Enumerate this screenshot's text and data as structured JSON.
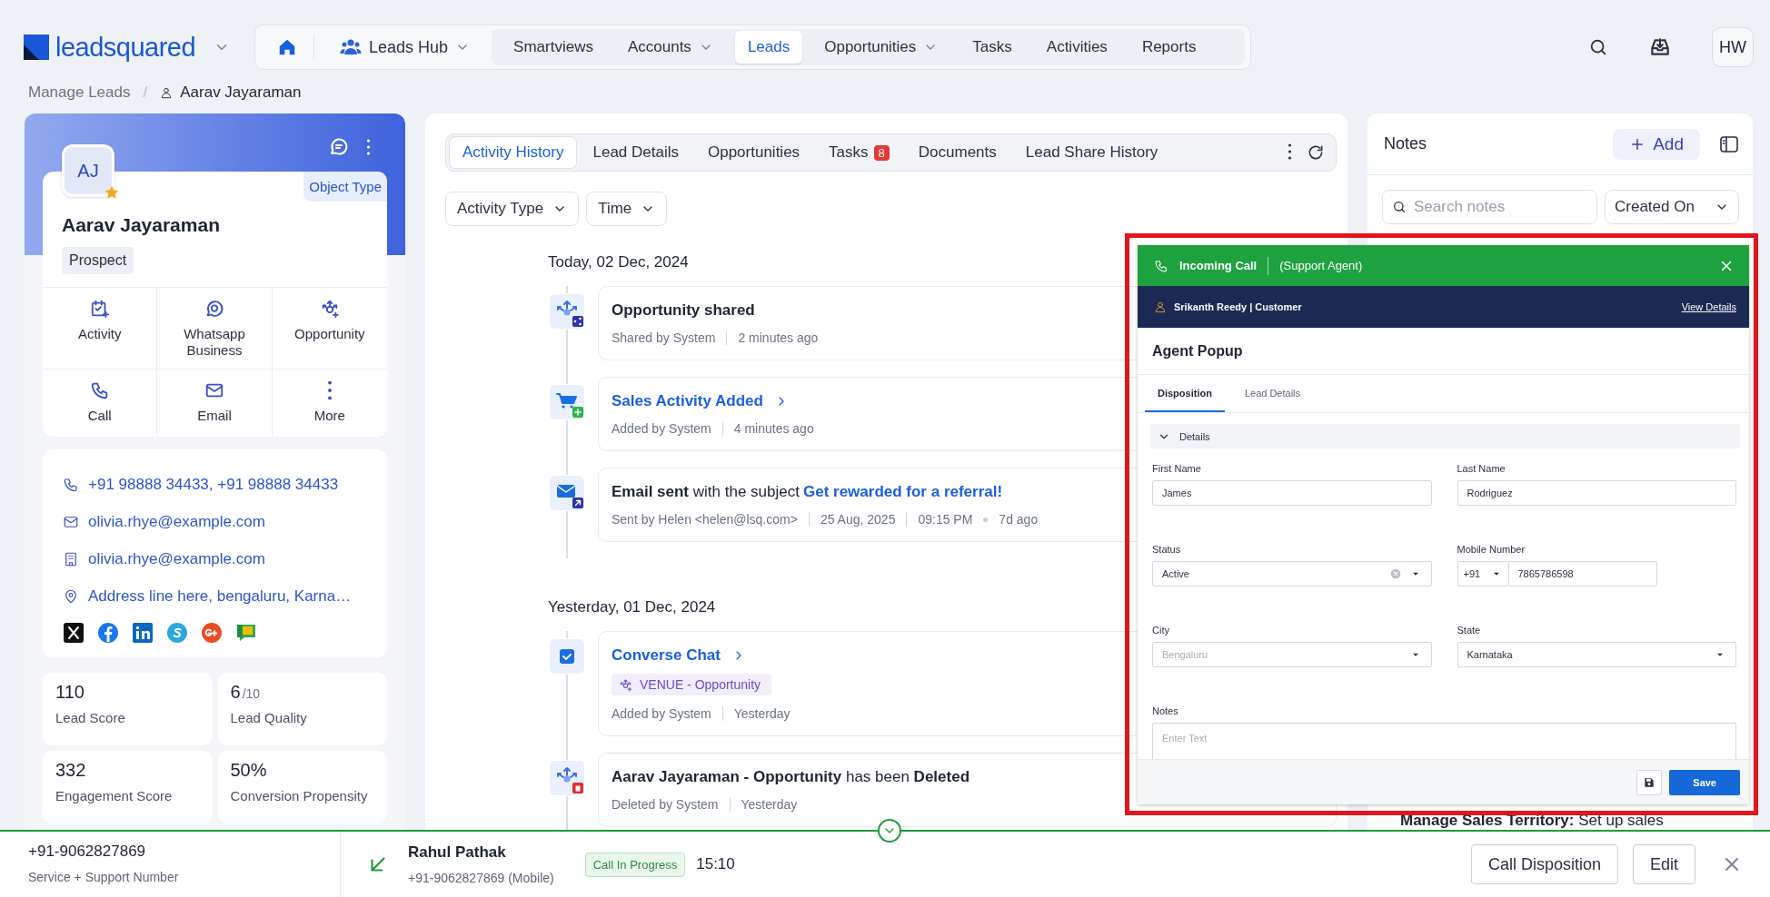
{
  "header": {
    "logo": "leadsquared",
    "nav": [
      {
        "label": "Leads Hub",
        "kind": "hub",
        "dropdown": true,
        "selected": false
      },
      {
        "label": "Smartviews",
        "kind": "link",
        "dropdown": false,
        "selected": false
      },
      {
        "label": "Accounts",
        "kind": "link",
        "dropdown": true,
        "selected": false
      },
      {
        "label": "Leads",
        "kind": "link",
        "dropdown": false,
        "selected": true
      },
      {
        "label": "Opportunities",
        "kind": "link",
        "dropdown": true,
        "selected": false
      },
      {
        "label": "Tasks",
        "kind": "link",
        "dropdown": false,
        "selected": false
      },
      {
        "label": "Activities",
        "kind": "link",
        "dropdown": false,
        "selected": false
      },
      {
        "label": "Reports",
        "kind": "link",
        "dropdown": false,
        "selected": false
      }
    ],
    "avatar": "HW"
  },
  "breadcrumb": {
    "separator": "/",
    "items": [
      {
        "label": "Manage Leads",
        "kind": "link"
      },
      {
        "label": "Aarav Jayaraman",
        "kind": "person"
      }
    ]
  },
  "lead": {
    "initials": "AJ",
    "starred": true,
    "object_type": "Object Type",
    "name": "Aarav Jayaraman",
    "stage": "Prospect",
    "actions": [
      {
        "label": "Activity",
        "kind": "activity"
      },
      {
        "label": "Whatsapp Business",
        "kind": "whatsapp"
      },
      {
        "label": "Opportunity",
        "kind": "opportunity"
      },
      {
        "label": "Call",
        "kind": "call"
      },
      {
        "label": "Email",
        "kind": "email"
      },
      {
        "label": "More",
        "kind": "more"
      }
    ],
    "contacts": [
      {
        "kind": "phone",
        "text": "+91 98888 34433, +91 98888 34433"
      },
      {
        "kind": "email",
        "text": "olivia.rhye@example.com"
      },
      {
        "kind": "company",
        "text": "olivia.rhye@example.com"
      },
      {
        "kind": "address",
        "text": "Address line here, bengaluru, Karna…"
      }
    ],
    "metrics": [
      {
        "value": "110",
        "label": "Lead Score"
      },
      {
        "value": "6",
        "scale": "/10",
        "label": "Lead Quality"
      },
      {
        "value": "332",
        "label": "Engagement Score"
      },
      {
        "value": "50%",
        "label": "Conversion Propensity"
      }
    ]
  },
  "activity": {
    "tabs": [
      {
        "label": "Activity History",
        "selected": true
      },
      {
        "label": "Lead Details",
        "selected": false
      },
      {
        "label": "Opportunities",
        "selected": false
      },
      {
        "label": "Tasks",
        "badge": "8",
        "selected": false
      },
      {
        "label": "Documents",
        "selected": false
      },
      {
        "label": "Lead Share History",
        "selected": false
      }
    ],
    "filters": [
      "Activity Type",
      "Time"
    ],
    "groups": [
      {
        "date": "Today, 02 Dec, 2024",
        "items": [
          {
            "kind": "opportunity_shared",
            "title": "Opportunity shared",
            "bold": true,
            "linked": false,
            "meta": [
              "Shared by System",
              "2 minutes ago"
            ]
          },
          {
            "kind": "sales",
            "title": "Sales Activity Added",
            "bold": false,
            "linked": true,
            "meta": [
              "Added by System",
              "4 minutes ago"
            ]
          },
          {
            "kind": "email",
            "title": "**Email sent** with the subject",
            "link": "Get rewarded for a referral!",
            "bold": false,
            "linked": false,
            "meta": [
              "Sent by Helen <helen@lsq.com>",
              "25 Aug, 2025",
              "09:15 PM"
            ],
            "ago": "7d ago"
          }
        ]
      },
      {
        "date": "Yesterday, 01 Dec, 2024",
        "items": [
          {
            "kind": "chat",
            "title": "Converse Chat",
            "bold": false,
            "linked": true,
            "tag": "VENUE - Opportunity",
            "meta": [
              "Added by System",
              "Yesterday"
            ]
          },
          {
            "kind": "opportunity_deleted",
            "title": "**Aarav Jayaraman - Opportunity** has been **Deleted**",
            "bold": false,
            "linked": false,
            "meta": [
              "Deleted by System",
              "Yesterday"
            ]
          }
        ]
      }
    ]
  },
  "notes": {
    "title": "Notes",
    "add": "Add",
    "search_placeholder": "Search notes",
    "sort": "Created On",
    "snippet": "**Manage Sales Territory:** Set up sales"
  },
  "call_popup": {
    "title": "Incoming Call",
    "role": "(Support Agent)",
    "caller": "Srikanth Reedy | Customer",
    "view": "View Details",
    "heading": "Agent Popup",
    "tabs": [
      {
        "label": "Disposition",
        "selected": true
      },
      {
        "label": "Lead Details",
        "selected": false
      }
    ],
    "section": {
      "label": "Details",
      "expanded": true
    },
    "fields": [
      {
        "label": "First Name",
        "kind": "text",
        "value": "James"
      },
      {
        "label": "Last Name",
        "kind": "text",
        "value": "Rodriguez"
      },
      {
        "label": "Status",
        "kind": "select",
        "value": "Active",
        "clearable": true
      },
      {
        "label": "Mobile Number",
        "kind": "phone",
        "code": "+91",
        "value": "7865786598"
      },
      {
        "label": "City",
        "kind": "select",
        "placeholder": "Bengaluru",
        "clearable": false
      },
      {
        "label": "State",
        "kind": "select",
        "value": "Karnataka",
        "clearable": false
      },
      {
        "label": "Notes",
        "kind": "textarea",
        "placeholder": "Enter Text"
      }
    ],
    "save": "Save"
  },
  "call_bar": {
    "number": "+91-9062827869",
    "number_label": "Service + Support Number",
    "contact": "Rahul Pathak",
    "contact_number": "+91-9062827869 (Mobile)",
    "status": "Call In Progress",
    "timer": "15:10",
    "buttons": [
      "Call Disposition",
      "Edit"
    ]
  }
}
